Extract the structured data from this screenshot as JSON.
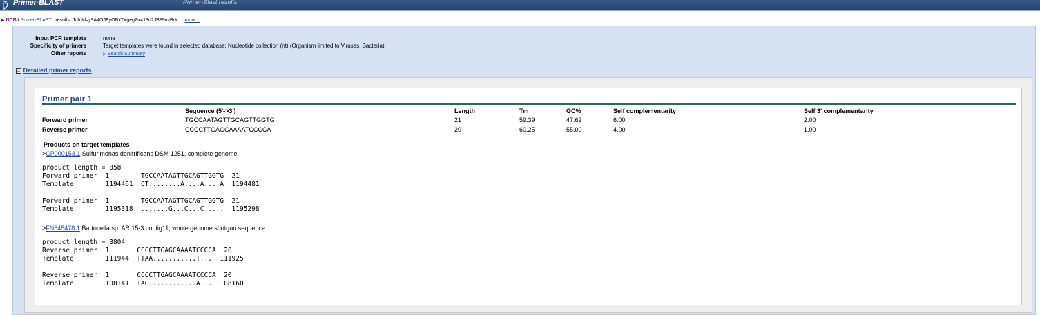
{
  "header": {
    "app_title": "Primer-BLAST",
    "page_title": "Primer-Blast results"
  },
  "breadcrumb": {
    "ncbi": "NCBI/",
    "tool": "Primer-BLAST",
    "text": ": results: Job Id=y9A4OJEyOBYDrgegZo413n2JB89uvBrK",
    "more": "more..."
  },
  "summary": {
    "template_label": "Input PCR template",
    "template_value": "none",
    "specificity_label": "Specificity of primers",
    "specificity_value": "Target templates were found in selected database: Nucleotide collection (nt) (Organism limited to Viruses, Bacteria)",
    "other_label": "Other reports",
    "search_summary": "Search Summary"
  },
  "detailed": {
    "label": "Detailed primer reports"
  },
  "primer_pair": {
    "title": "Primer pair 1",
    "headers": [
      "Sequence (5'->3')",
      "Length",
      "Tm",
      "GC%",
      "Self complementarity",
      "Self 3' complementarity"
    ],
    "rows": [
      {
        "label": "Forward primer",
        "sequence": "TGCCAATAGTTGCAGTTGGTG",
        "length": "21",
        "tm": "59.39",
        "gc": "47.62",
        "self_comp": "6.00",
        "self3": "2.00"
      },
      {
        "label": "Reverse primer",
        "sequence": "CCCCTTGAGCAAAATCCCCA",
        "length": "20",
        "tm": "60.25",
        "gc": "55.00",
        "self_comp": "4.00",
        "self3": "1.00"
      }
    ]
  },
  "products": {
    "title": "Products on target templates",
    "hits": [
      {
        "prefix": ">",
        "accession": "CP000153.1",
        "description": "Sulfurimonas denitrificans DSM 1251, complete genome",
        "alignment": "product length = 858\nForward primer  1        TGCCAATAGTTGCAGTTGGTG  21\nTemplate        1194461  CT........A....A....A  1194481\n\nForward primer  1        TGCCAATAGTTGCAGTTGGTG  21\nTemplate        1195318  .......G...C...C.....  1195298"
      },
      {
        "prefix": ">",
        "accession": "FN645478.1",
        "description": "Bartonella sp. AR 15-3 contig11, whole genome shotgun sequence",
        "alignment": "product length = 3804\nReverse primer  1       CCCCTTGAGCAAAATCCCCA  20\nTemplate        111944  TTAA...........T...  111925\n\nReverse primer  1       CCCCTTGAGCAAAATCCCCA  20\nTemplate        108141  TAG............A...  108160"
      }
    ]
  },
  "colors": {
    "header_bar": "#26456f",
    "summary_bg": "#d6e2f2",
    "link": "#1d4fa0",
    "primer_title": "#1f4a7c",
    "rule": "#2d6468"
  }
}
